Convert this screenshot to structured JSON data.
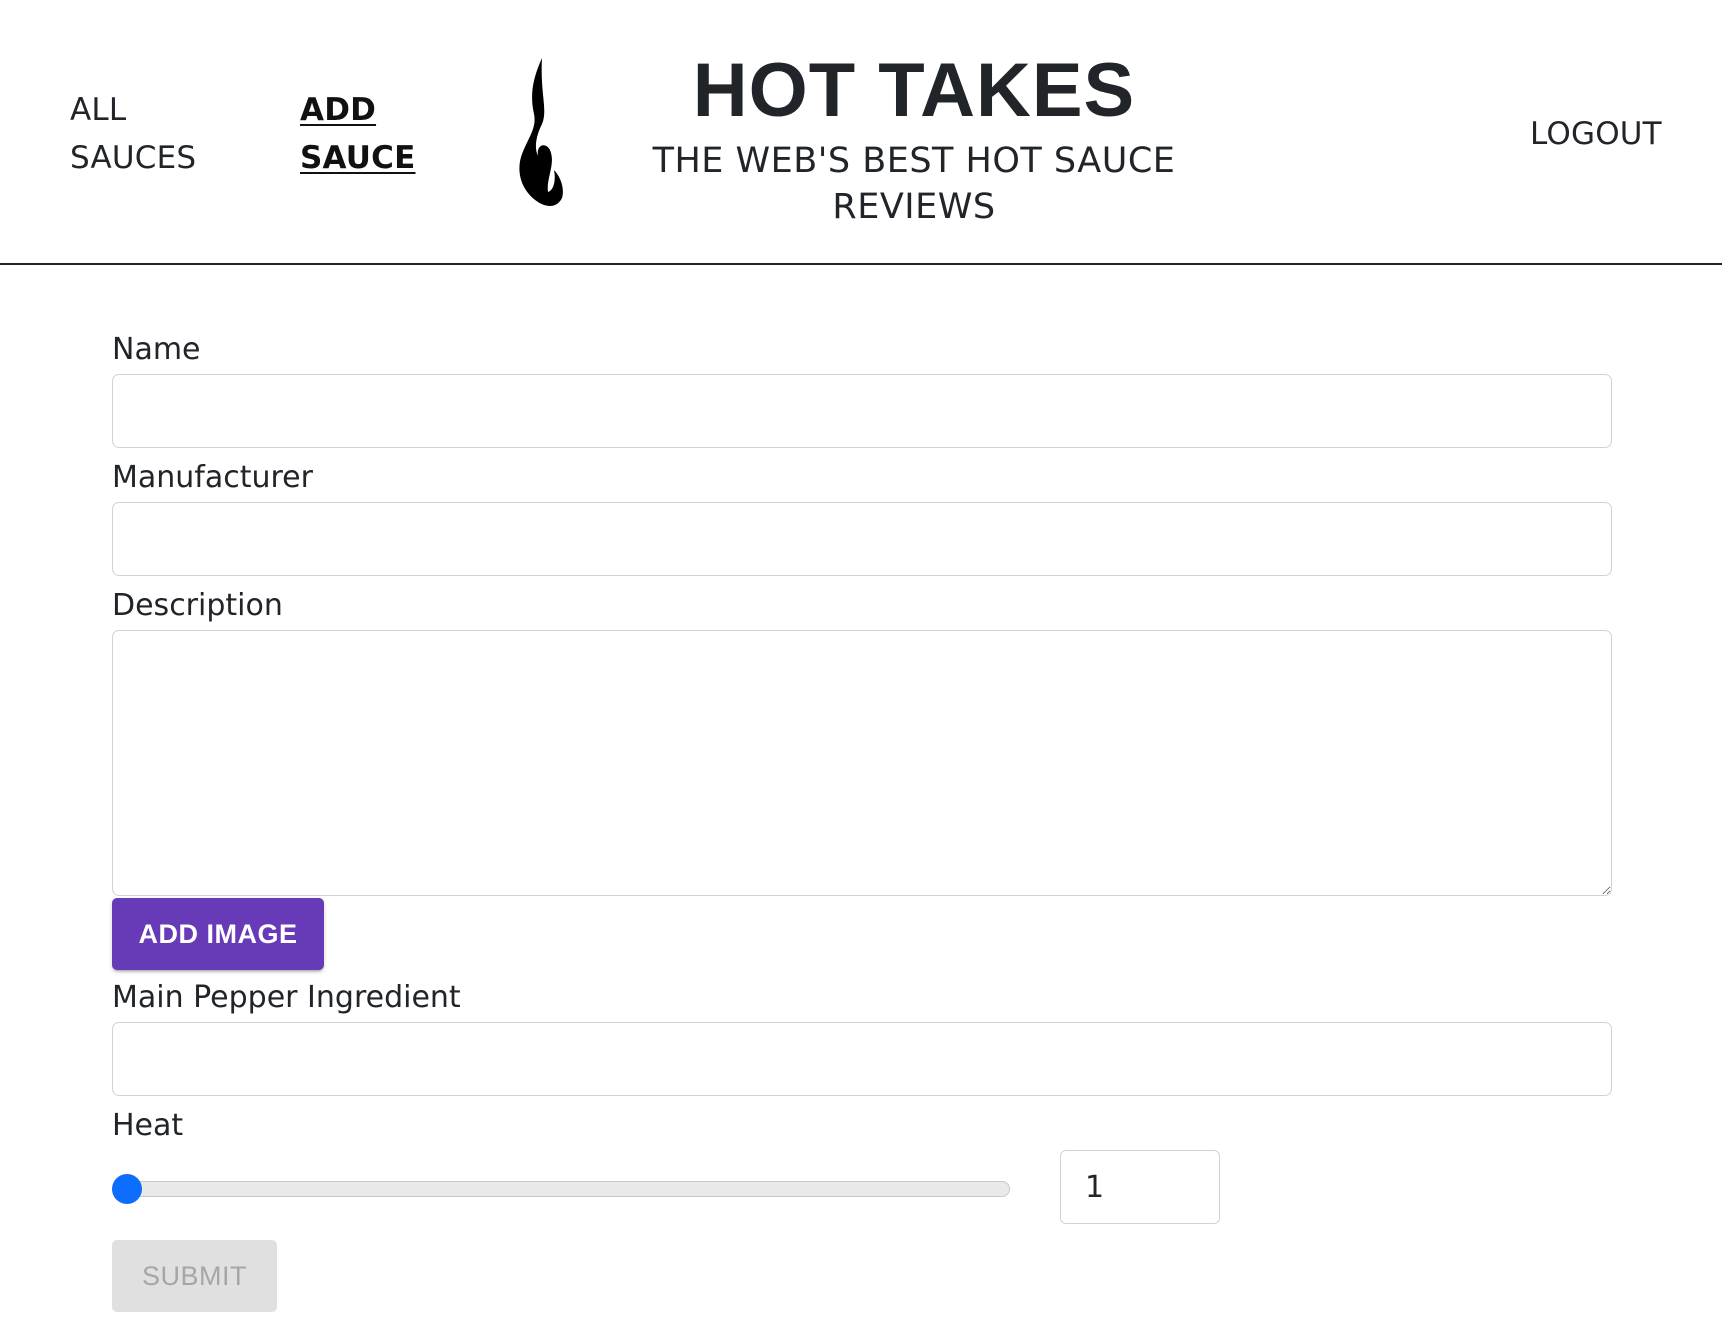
{
  "nav": {
    "all_sauces": "ALL SAUCES",
    "add_sauce": "ADD SAUCE",
    "logout": "LOGOUT"
  },
  "brand": {
    "logo_icon": "flame-icon",
    "title": "HOT TAKES",
    "subtitle": "THE WEB'S BEST HOT SAUCE REVIEWS"
  },
  "form": {
    "name": {
      "label": "Name",
      "value": ""
    },
    "manufacturer": {
      "label": "Manufacturer",
      "value": ""
    },
    "description": {
      "label": "Description",
      "value": ""
    },
    "add_image_label": "ADD IMAGE",
    "main_pepper": {
      "label": "Main Pepper Ingredient",
      "value": ""
    },
    "heat": {
      "label": "Heat",
      "value": "1",
      "min": 1,
      "max": 10
    },
    "submit_label": "SUBMIT",
    "submit_disabled": true
  },
  "colors": {
    "accent": "#673ab7",
    "slider_thumb": "#0d6efd",
    "disabled_bg": "#e0e0e0",
    "disabled_text": "#a6a6a6",
    "text": "#212529"
  }
}
